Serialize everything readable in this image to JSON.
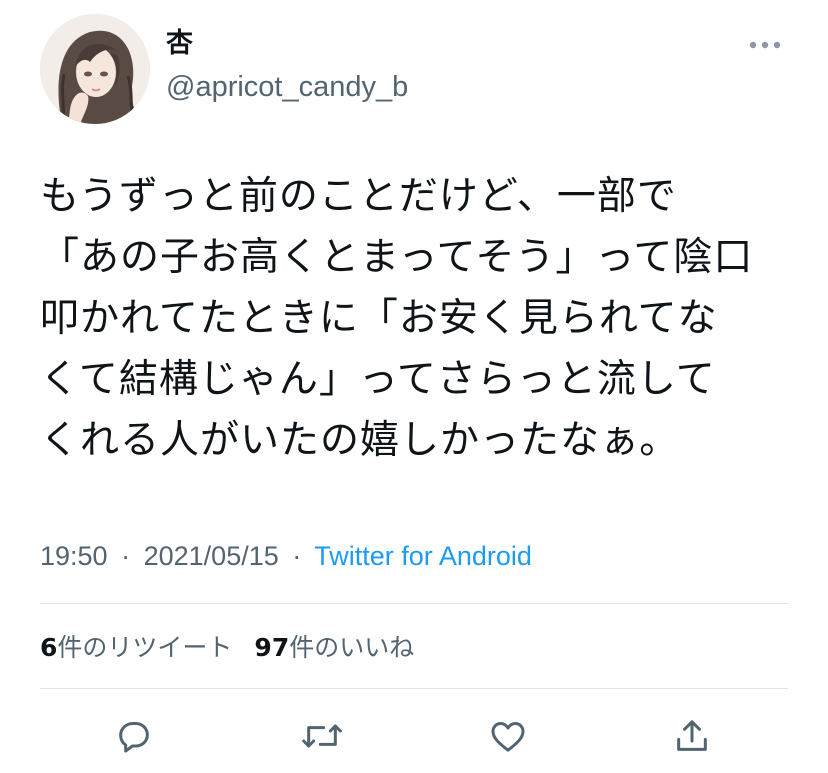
{
  "user": {
    "display_name": "杏",
    "handle": "@apricot_candy_b",
    "avatar_icon": "profile-avatar-illustration"
  },
  "tweet": {
    "text": "もうずっと前のことだけど、一部で\n「あの子お高くとまってそう」って陰口\n叩かれてたときに「お安く見られてな\nくて結構じゃん」ってさらっと流して\nくれる人がいたの嬉しかったなぁ。"
  },
  "meta": {
    "time": "19:50",
    "separator": "·",
    "date": "2021/05/15",
    "source": "Twitter for Android"
  },
  "stats": {
    "retweet_count": "6",
    "retweet_label": "件のリツイート",
    "like_count": "97",
    "like_label": "件のいいね"
  },
  "actions": {
    "icons": [
      "reply-icon",
      "retweet-icon",
      "like-icon",
      "share-icon"
    ]
  },
  "colors": {
    "text": "#0f1419",
    "secondary": "#536471",
    "accent": "#1d9bf0",
    "divider": "#e1e5e8",
    "icon": "#536471"
  }
}
